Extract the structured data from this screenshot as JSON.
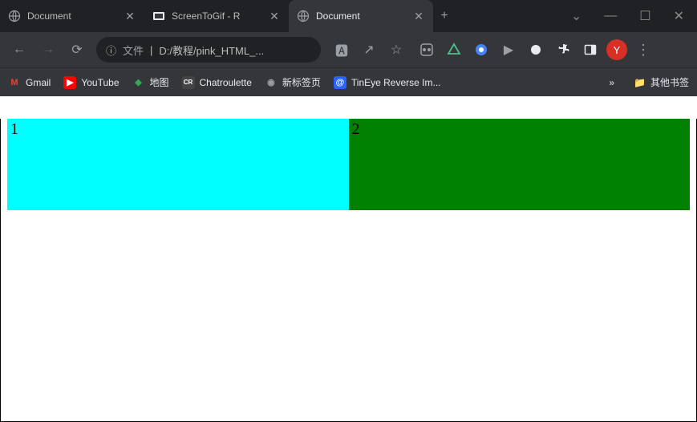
{
  "tabs": [
    {
      "title": "Document",
      "favicon": "globe"
    },
    {
      "title": "ScreenToGif - R",
      "favicon": "screentogif"
    },
    {
      "title": "Document",
      "favicon": "globe",
      "active": true
    }
  ],
  "window": {
    "dropdown": "⌄",
    "minimize": "—",
    "maximize": "☐",
    "close": "✕"
  },
  "nav": {
    "back": "←",
    "forward": "→",
    "reload": "⟳"
  },
  "omnibox": {
    "info": "ⓘ",
    "prefix": "文件",
    "sep": "|",
    "url": "D:/教程/pink_HTML_..."
  },
  "toolbar_icons": {
    "translate": "🅰",
    "share": "↗",
    "star": "☆"
  },
  "overflow": "⋮",
  "avatar": {
    "letter": "Y",
    "bg": "#d93025"
  },
  "bookmarks": [
    {
      "label": "Gmail",
      "icon": "M",
      "bg": "transparent",
      "color": "#ea4335"
    },
    {
      "label": "YouTube",
      "icon": "▶",
      "bg": "#ff0000",
      "color": "#fff"
    },
    {
      "label": "地图",
      "icon": "◆",
      "bg": "transparent",
      "color": "#34a853"
    },
    {
      "label": "Chatroulette",
      "icon": "CR",
      "bg": "#444",
      "color": "#fff"
    },
    {
      "label": "新标签页",
      "icon": "●",
      "bg": "transparent",
      "color": "#9aa0a6"
    },
    {
      "label": "TinEye Reverse Im...",
      "icon": "@",
      "bg": "#2962ff",
      "color": "#fff"
    }
  ],
  "bm_overflow": "»",
  "other_bookmarks": {
    "icon": "📁",
    "label": "其他书签"
  },
  "content": {
    "box1": {
      "text": "1",
      "bg": "#00ffff"
    },
    "box2": {
      "text": "2",
      "bg": "#008000"
    }
  }
}
